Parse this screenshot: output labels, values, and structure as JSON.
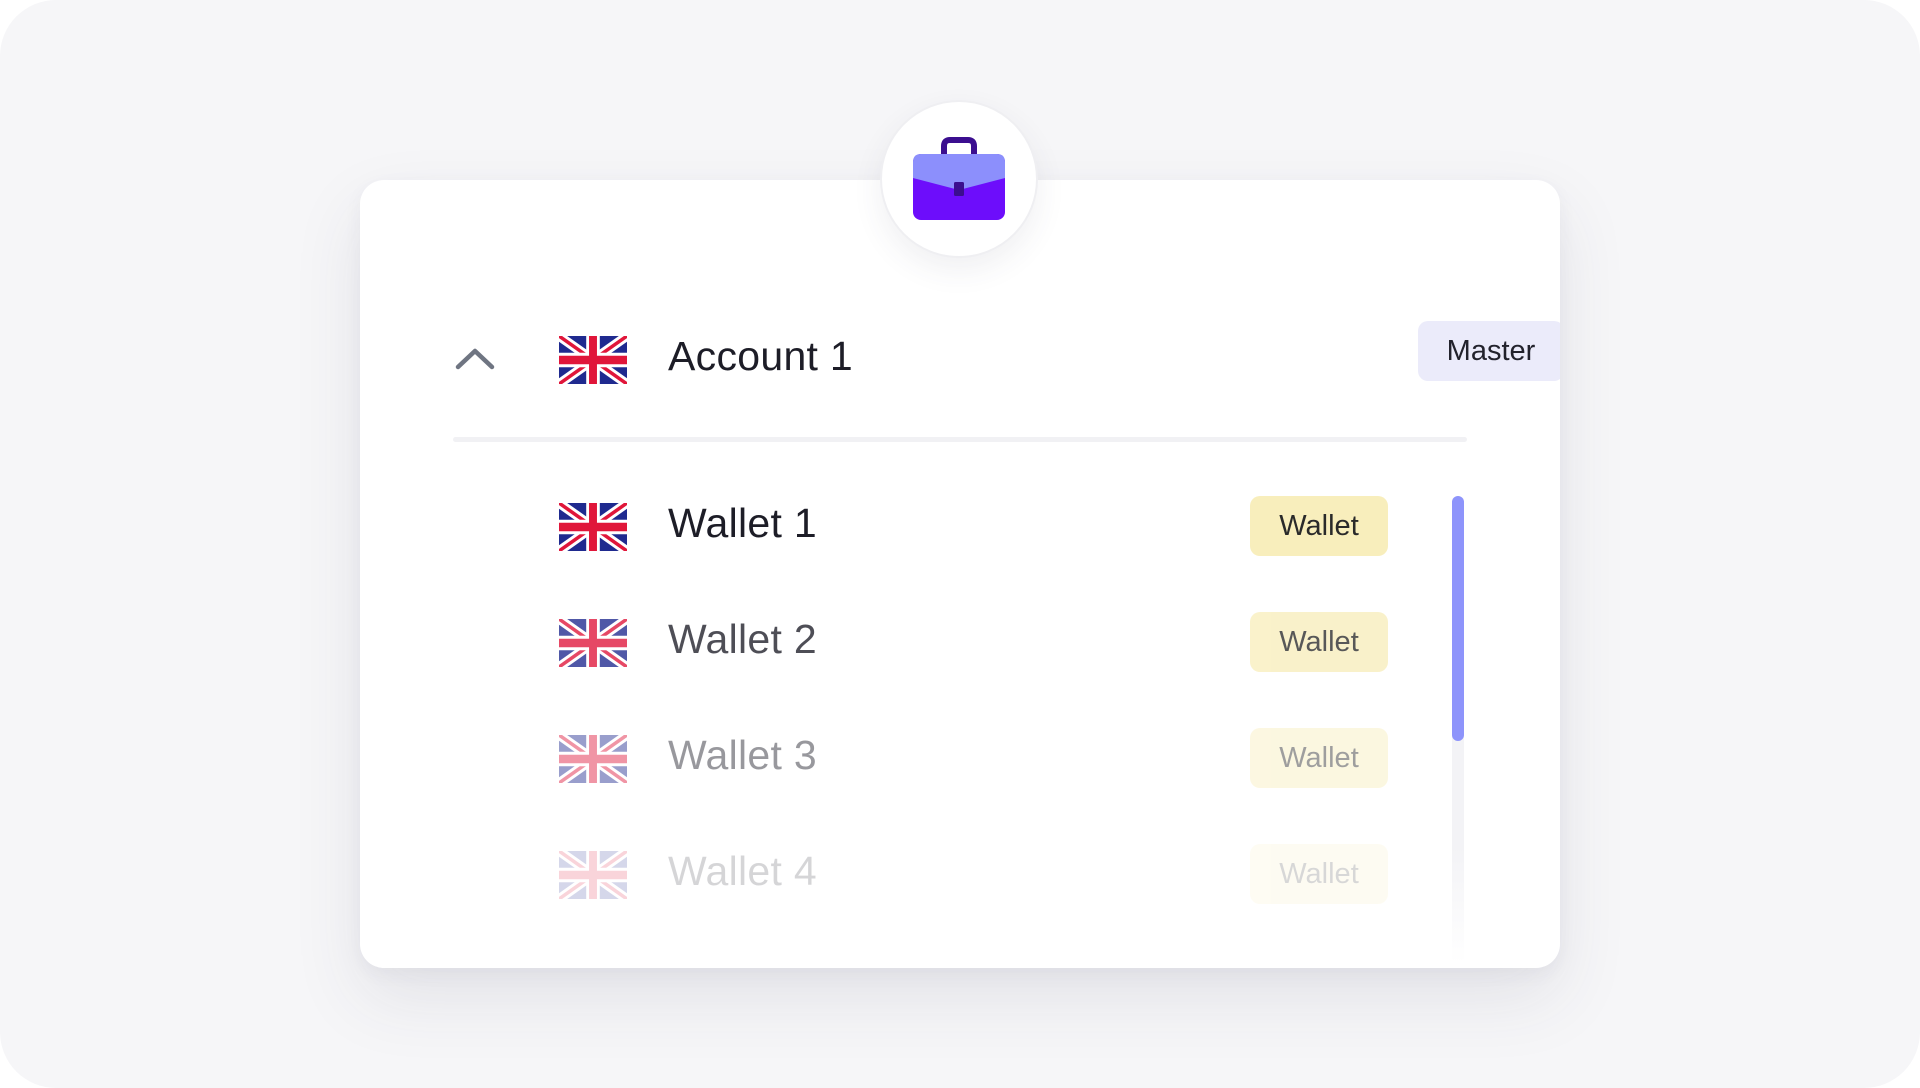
{
  "account": {
    "name": "Account 1",
    "badge": "Master",
    "expanded": true,
    "flag": "uk-flag-icon"
  },
  "wallets": [
    {
      "name": "Wallet 1",
      "badge": "Wallet",
      "flag": "uk-flag-icon"
    },
    {
      "name": "Wallet 2",
      "badge": "Wallet",
      "flag": "uk-flag-icon"
    },
    {
      "name": "Wallet 3",
      "badge": "Wallet",
      "flag": "uk-flag-icon"
    },
    {
      "name": "Wallet 4",
      "badge": "Wallet",
      "flag": "uk-flag-icon"
    }
  ],
  "icons": {
    "header": "briefcase-icon",
    "toggle": "chevron-up-icon"
  },
  "colors": {
    "briefcase_top": "#8c8ffc",
    "briefcase_body": "#6d0dfb",
    "briefcase_handle": "#3b0e8f",
    "master_badge_bg": "#ebebfa",
    "wallet_badge_bg": "#f8eebc",
    "scroll_thumb": "#8e94fb"
  }
}
